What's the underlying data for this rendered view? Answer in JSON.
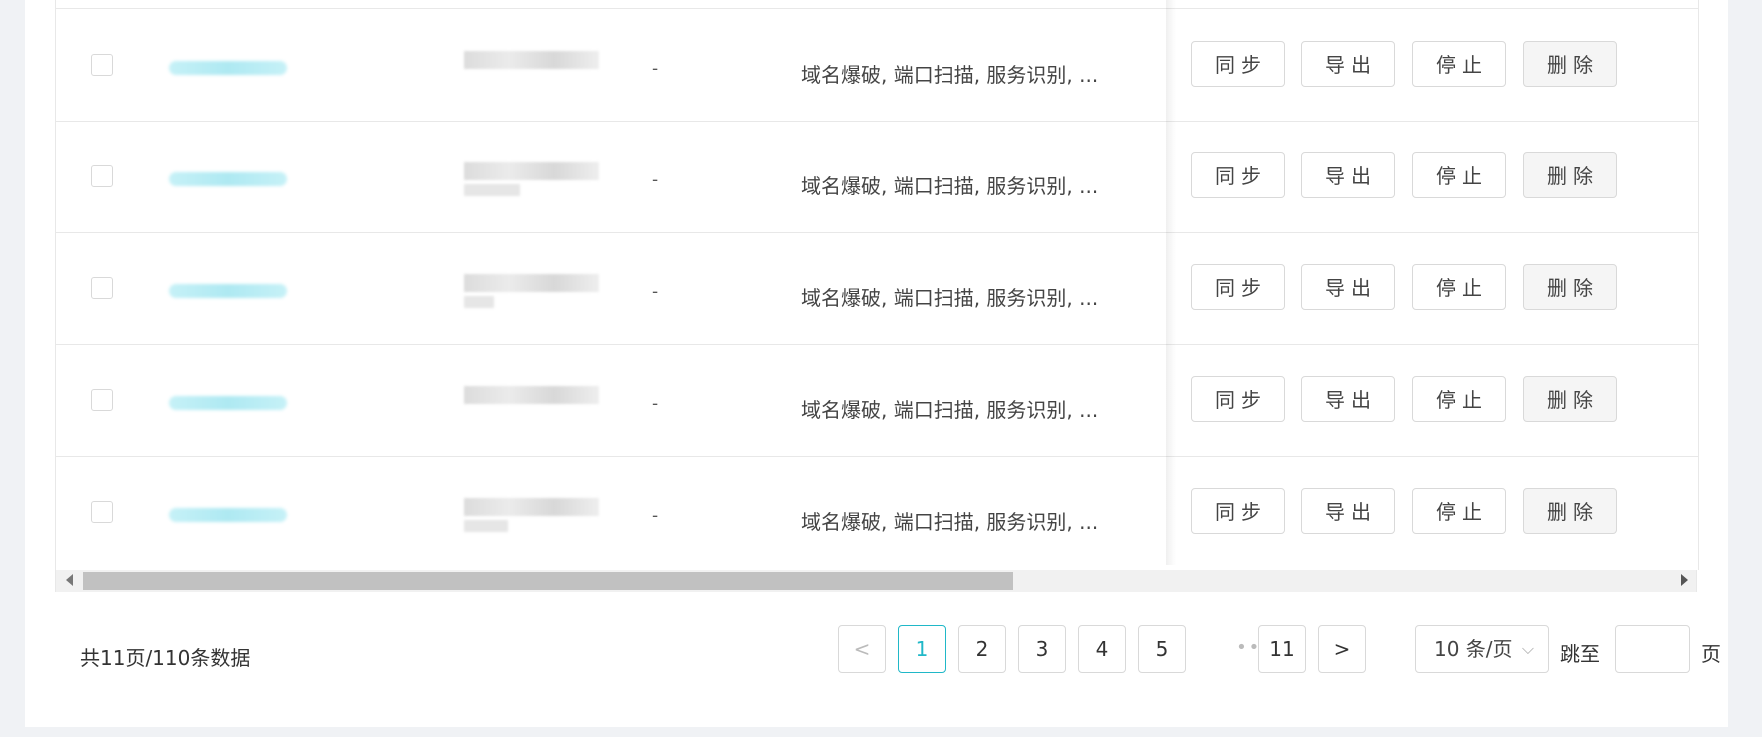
{
  "rows": [
    {
      "dash": "-",
      "scan_types": "域名爆破, 端口扫描, 服务识别, ...",
      "actions": {
        "sync": "同步",
        "export": "导出",
        "stop": "停止",
        "delete": "删除"
      }
    },
    {
      "dash": "-",
      "scan_types": "域名爆破, 端口扫描, 服务识别, ...",
      "actions": {
        "sync": "同步",
        "export": "导出",
        "stop": "停止",
        "delete": "删除"
      }
    },
    {
      "dash": "-",
      "scan_types": "域名爆破, 端口扫描, 服务识别, ...",
      "actions": {
        "sync": "同步",
        "export": "导出",
        "stop": "停止",
        "delete": "删除"
      }
    },
    {
      "dash": "-",
      "scan_types": "域名爆破, 端口扫描, 服务识别, ...",
      "actions": {
        "sync": "同步",
        "export": "导出",
        "stop": "停止",
        "delete": "删除"
      }
    },
    {
      "dash": "-",
      "scan_types": "域名爆破, 端口扫描, 服务识别, ...",
      "actions": {
        "sync": "同步",
        "export": "导出",
        "stop": "停止",
        "delete": "删除"
      }
    }
  ],
  "pagination": {
    "summary": "共11页/110条数据",
    "prev": "<",
    "pages": [
      "1",
      "2",
      "3",
      "4",
      "5"
    ],
    "ellipsis": "•••",
    "last": "11",
    "next": ">",
    "page_size": "10 条/页",
    "jump_label": "跳至",
    "page_label": "页",
    "jump_value": ""
  },
  "icons": {
    "prev": "chevron-left-icon",
    "next": "chevron-right-icon",
    "dropdown": "chevron-down-icon"
  },
  "colors": {
    "accent": "#20b8c8",
    "link_blur": "#aee9f2",
    "border": "#d9d9d9"
  }
}
